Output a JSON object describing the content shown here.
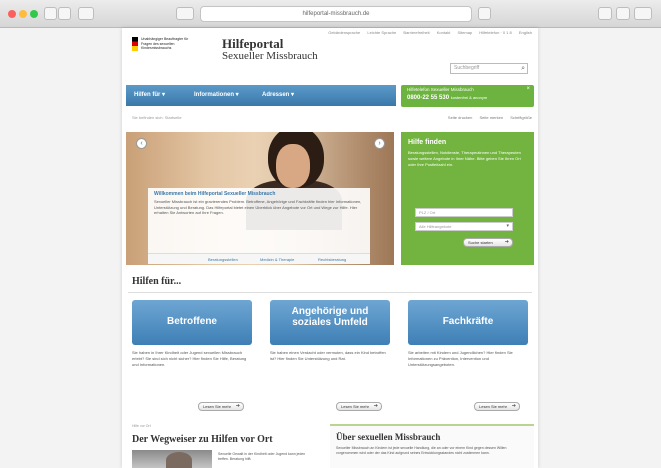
{
  "browser": {
    "url": "hilfeportal-missbrauch.de",
    "colors": {
      "close": "#fc605c",
      "minimize": "#fdbc40",
      "maximize": "#34c84a"
    }
  },
  "site": {
    "utility_links": [
      "Gebärdensprache",
      "Leichte Sprache",
      "Barrierefreiheit",
      "Kontakt",
      "Sitemap",
      "Hilfetelefon · 0 1 8",
      "English"
    ],
    "ministry": "Unabhängiger Beauftragter für Fragen des sexuellen Kindesmissbrauchs",
    "title": "Hilfeportal",
    "subtitle": "Sexueller Missbrauch",
    "search_placeholder": "Suchbegriff",
    "nav": [
      "Hilfen für ▾",
      "Informationen ▾",
      "Adressen ▾"
    ],
    "hotline": {
      "label": "Hilfetelefon Sexueller Missbrauch",
      "number": "0800-22 55 530",
      "note": "kostenfrei & anonym"
    },
    "breadcrumb": "Sie befinden sich: Startseite",
    "tools": [
      "Seite drucken",
      "Seite merken",
      "Schriftgröße"
    ],
    "hero": {
      "title": "Willkommen beim Hilfeportal Sexueller Missbrauch",
      "text": "Sexueller Missbrauch ist ein gravierendes Problem. Betroffene, Angehörige und Fachkräfte finden hier Informationen, Unterstützung und Beratung. Das Hilfeportal bietet einen Überblick über Angebote vor Ort und Wege zur Hilfe. Hier erhalten Sie Antworten auf Ihre Fragen.",
      "tabs": [
        "Beratungsstellen",
        "Medizin & Therapie",
        "Rechtsberatung"
      ]
    },
    "help_panel": {
      "title": "Hilfe finden",
      "text": "Beratungsstellen, Notdienste, Therapeutinnen und Therapeuten sowie weitere Angebote in Ihrer Nähe. Bitte geben Sie Ihren Ort oder Ihre Postleitzahl ein.",
      "plz_placeholder": "PLZ / Ort",
      "select": "Alle Hilfeangebote",
      "button": "Suche starten"
    },
    "section_title": "Hilfen für...",
    "cards": [
      {
        "title": "Betroffene",
        "text": "Sie haben in Ihrer Kindheit oder Jugend sexuellen Missbrauch erlebt? Sie sind sich nicht sicher? Hier finden Sie Hilfe, Beratung und Informationen.",
        "button": "Lesen Sie mehr"
      },
      {
        "title_line1": "Angehörige und",
        "title_line2": "soziales Umfeld",
        "text": "Sie haben einen Verdacht oder vermuten, dass ein Kind betroffen ist? Hier finden Sie Unterstützung und Rat.",
        "button": "Lesen Sie mehr"
      },
      {
        "title": "Fachkräfte",
        "text": "Sie arbeiten mit Kindern und Jugendlichen? Hier finden Sie Informationen zu Prävention, Intervention und Unterstützungsangeboten.",
        "button": "Lesen Sie mehr"
      }
    ],
    "wegweiser_small": "Hilfe vor Ort",
    "wegweiser": "Der Wegweiser zu Hilfen vor Ort",
    "wegweiser_text": "Sexuelle Gewalt in der Kindheit oder Jugend kann jeden treffen. Beratung hilft.",
    "about_title": "Über sexuellen Missbrauch",
    "about_text": "Sexueller Missbrauch an Kindern ist jede sexuelle Handlung, die an oder vor einem Kind gegen dessen Willen vorgenommen wird oder der das Kind aufgrund seines Entwicklungsstandes nicht zustimmen kann."
  }
}
